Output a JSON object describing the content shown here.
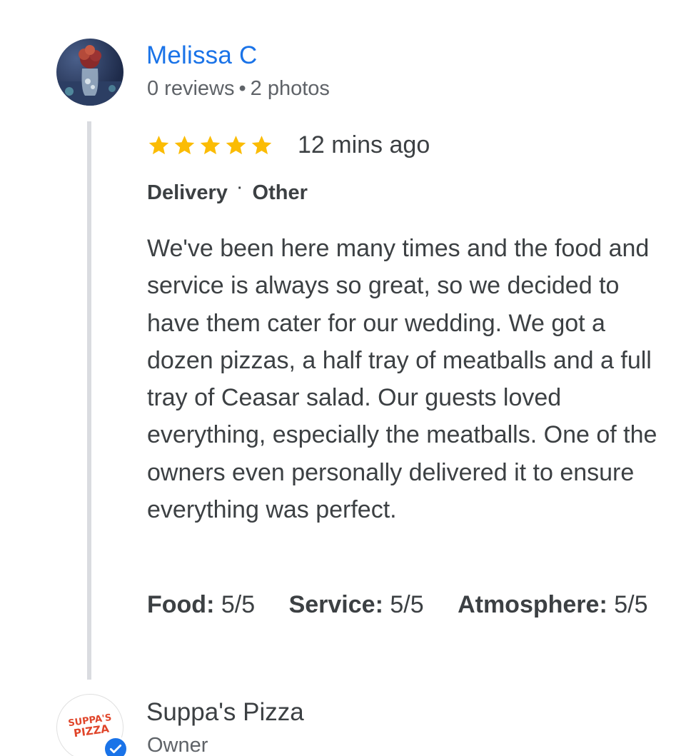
{
  "review": {
    "reviewer": {
      "name": "Melissa C",
      "reviews_count": "0 reviews",
      "separator": "•",
      "photos_count": "2 photos",
      "avatar_icon": "user-photo-flowers"
    },
    "rating": {
      "stars": 5,
      "max_stars": 5,
      "star_color": "#fbbc04",
      "time": "12 mins ago"
    },
    "tags": {
      "service_type": "Delivery",
      "separator": "·",
      "meal_type": "Other"
    },
    "text": "We've been here many times and the food and service is always so great, so we decided to have them cater for our wedding. We got a dozen pizzas, a half tray of meatballs and a full tray of Ceasar salad. Our guests loved everything, especially the meatballs. One of the owners even personally delivered it to ensure everything was perfect.",
    "sub_ratings": [
      {
        "label": "Food:",
        "value": "5/5"
      },
      {
        "label": "Service:",
        "value": "5/5"
      },
      {
        "label": "Atmosphere:",
        "value": "5/5"
      }
    ]
  },
  "owner_reply": {
    "name": "Suppa's Pizza",
    "role": "Owner",
    "logo_line1": "SUPPA'S",
    "logo_line2": "PIZZA",
    "verified_icon": "check-icon",
    "link_color": "#1a73e8"
  }
}
